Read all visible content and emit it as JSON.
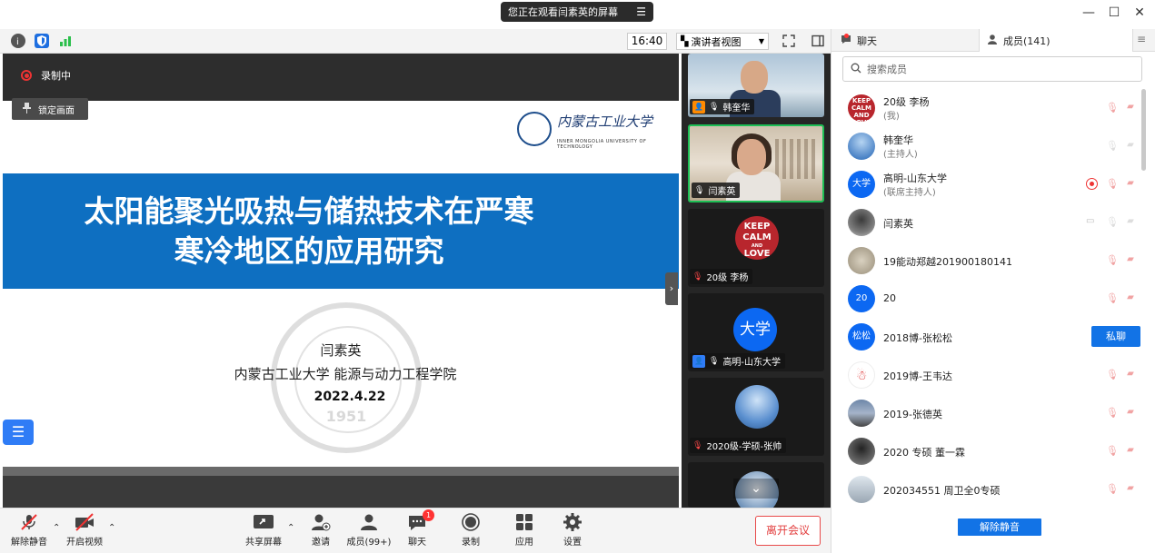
{
  "titlebar": {
    "viewing_notice": "您正在观看闫素英的屏幕",
    "menu_glyph": "☰",
    "minimize": "—",
    "maximize": "☐",
    "close": "✕"
  },
  "toolbar": {
    "time": "16:40",
    "view_mode": "演讲者视图"
  },
  "share": {
    "recording_label": "录制中",
    "lock_screen_label": "锁定画面",
    "slide": {
      "logo_text": "内蒙古工业大学",
      "logo_sub": "INNER MONGOLIA UNIVERSITY OF TECHNOLOGY",
      "title_line1": "太阳能聚光吸热与储热技术在严寒",
      "title_line2": "寒冷地区的应用研究",
      "author": "闫素英",
      "institution": "内蒙古工业大学 能源与动力工程学院",
      "date": "2022.4.22",
      "seal_year": "1951"
    }
  },
  "video_strip": {
    "tiles": [
      {
        "name": "韩奎华",
        "role_icon": "host"
      },
      {
        "name": "闫素英",
        "role_icon": "none"
      },
      {
        "name": "20级 李杨",
        "role_icon": "none",
        "avatar_text": [
          "KEEP",
          "CALM",
          "AND",
          "LOVE"
        ]
      },
      {
        "name": "高明-山东大学",
        "role_icon": "cohost",
        "avatar_text": "大学"
      },
      {
        "name": "2020级-学硕-张帅",
        "role_icon": "none"
      }
    ]
  },
  "bottombar": {
    "unmute": "解除静音",
    "start_video": "开启视频",
    "share_screen": "共享屏幕",
    "invite": "邀请",
    "members": "成员(99+)",
    "chat": "聊天",
    "chat_badge": "1",
    "record": "录制",
    "apps": "应用",
    "settings": "设置",
    "leave": "离开会议"
  },
  "panel": {
    "tab_chat": "聊天",
    "tab_members": "成员(141)",
    "search_placeholder": "搜索成员",
    "members": [
      {
        "name": "20级 李杨",
        "role": "(我)",
        "avatar": "keep",
        "avatar_text": "KEEP CALM AND LOVE"
      },
      {
        "name": "韩奎华",
        "role": "(主持人)",
        "avatar": "sky"
      },
      {
        "name": "高明-山东大学",
        "role": "(联席主持人)",
        "avatar": "blue",
        "avatar_text": "大学"
      },
      {
        "name": "闫素英",
        "role": "",
        "avatar": "person"
      },
      {
        "name": "19能动郑越201900180141",
        "role": "",
        "avatar": "flower"
      },
      {
        "name": "20",
        "role": "",
        "avatar": "blue",
        "avatar_text": "20"
      },
      {
        "name": "2018博-张松松",
        "role": "",
        "avatar": "blue",
        "avatar_text": "松松"
      },
      {
        "name": "2019博-王韦达",
        "role": "",
        "avatar": "xmas"
      },
      {
        "name": "2019-张德英",
        "role": "",
        "avatar": "dusk"
      },
      {
        "name": "2020 专硕 董一霖",
        "role": "",
        "avatar": "darkp"
      },
      {
        "name": "202034551  周卫全0专硕",
        "role": "",
        "avatar": "mountain"
      }
    ],
    "private_chat": "私聊",
    "unmute_all": "解除静音"
  }
}
